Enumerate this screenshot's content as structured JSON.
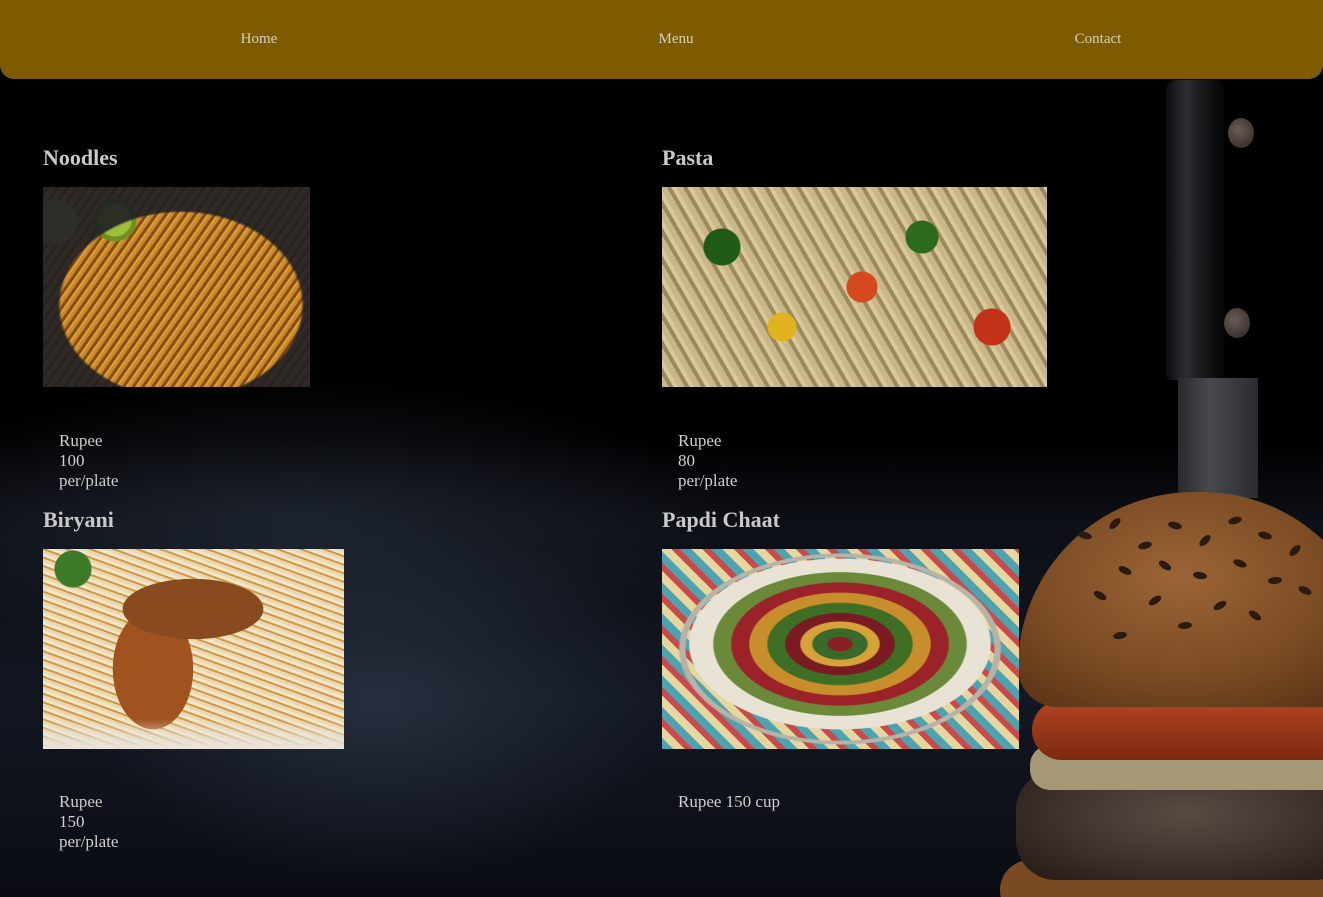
{
  "nav": {
    "items": [
      {
        "label": "Home"
      },
      {
        "label": "Menu"
      },
      {
        "label": "Contact"
      }
    ]
  },
  "menu": {
    "items": [
      {
        "name": "Noodles",
        "price": "Rupee 100 per/plate",
        "image": "noodles-photo"
      },
      {
        "name": "Pasta",
        "price": "Rupee 80 per/plate",
        "image": "pasta-photo"
      },
      {
        "name": "Biryani",
        "price": "Rupee 150 per/plate",
        "image": "biryani-photo"
      },
      {
        "name": "Papdi Chaat",
        "price": "Rupee 150 cup",
        "image": "papdi-chaat-photo"
      }
    ]
  },
  "colors": {
    "navbar": "#7f5b00",
    "background": "#000000",
    "text": "#c9c9c9"
  }
}
